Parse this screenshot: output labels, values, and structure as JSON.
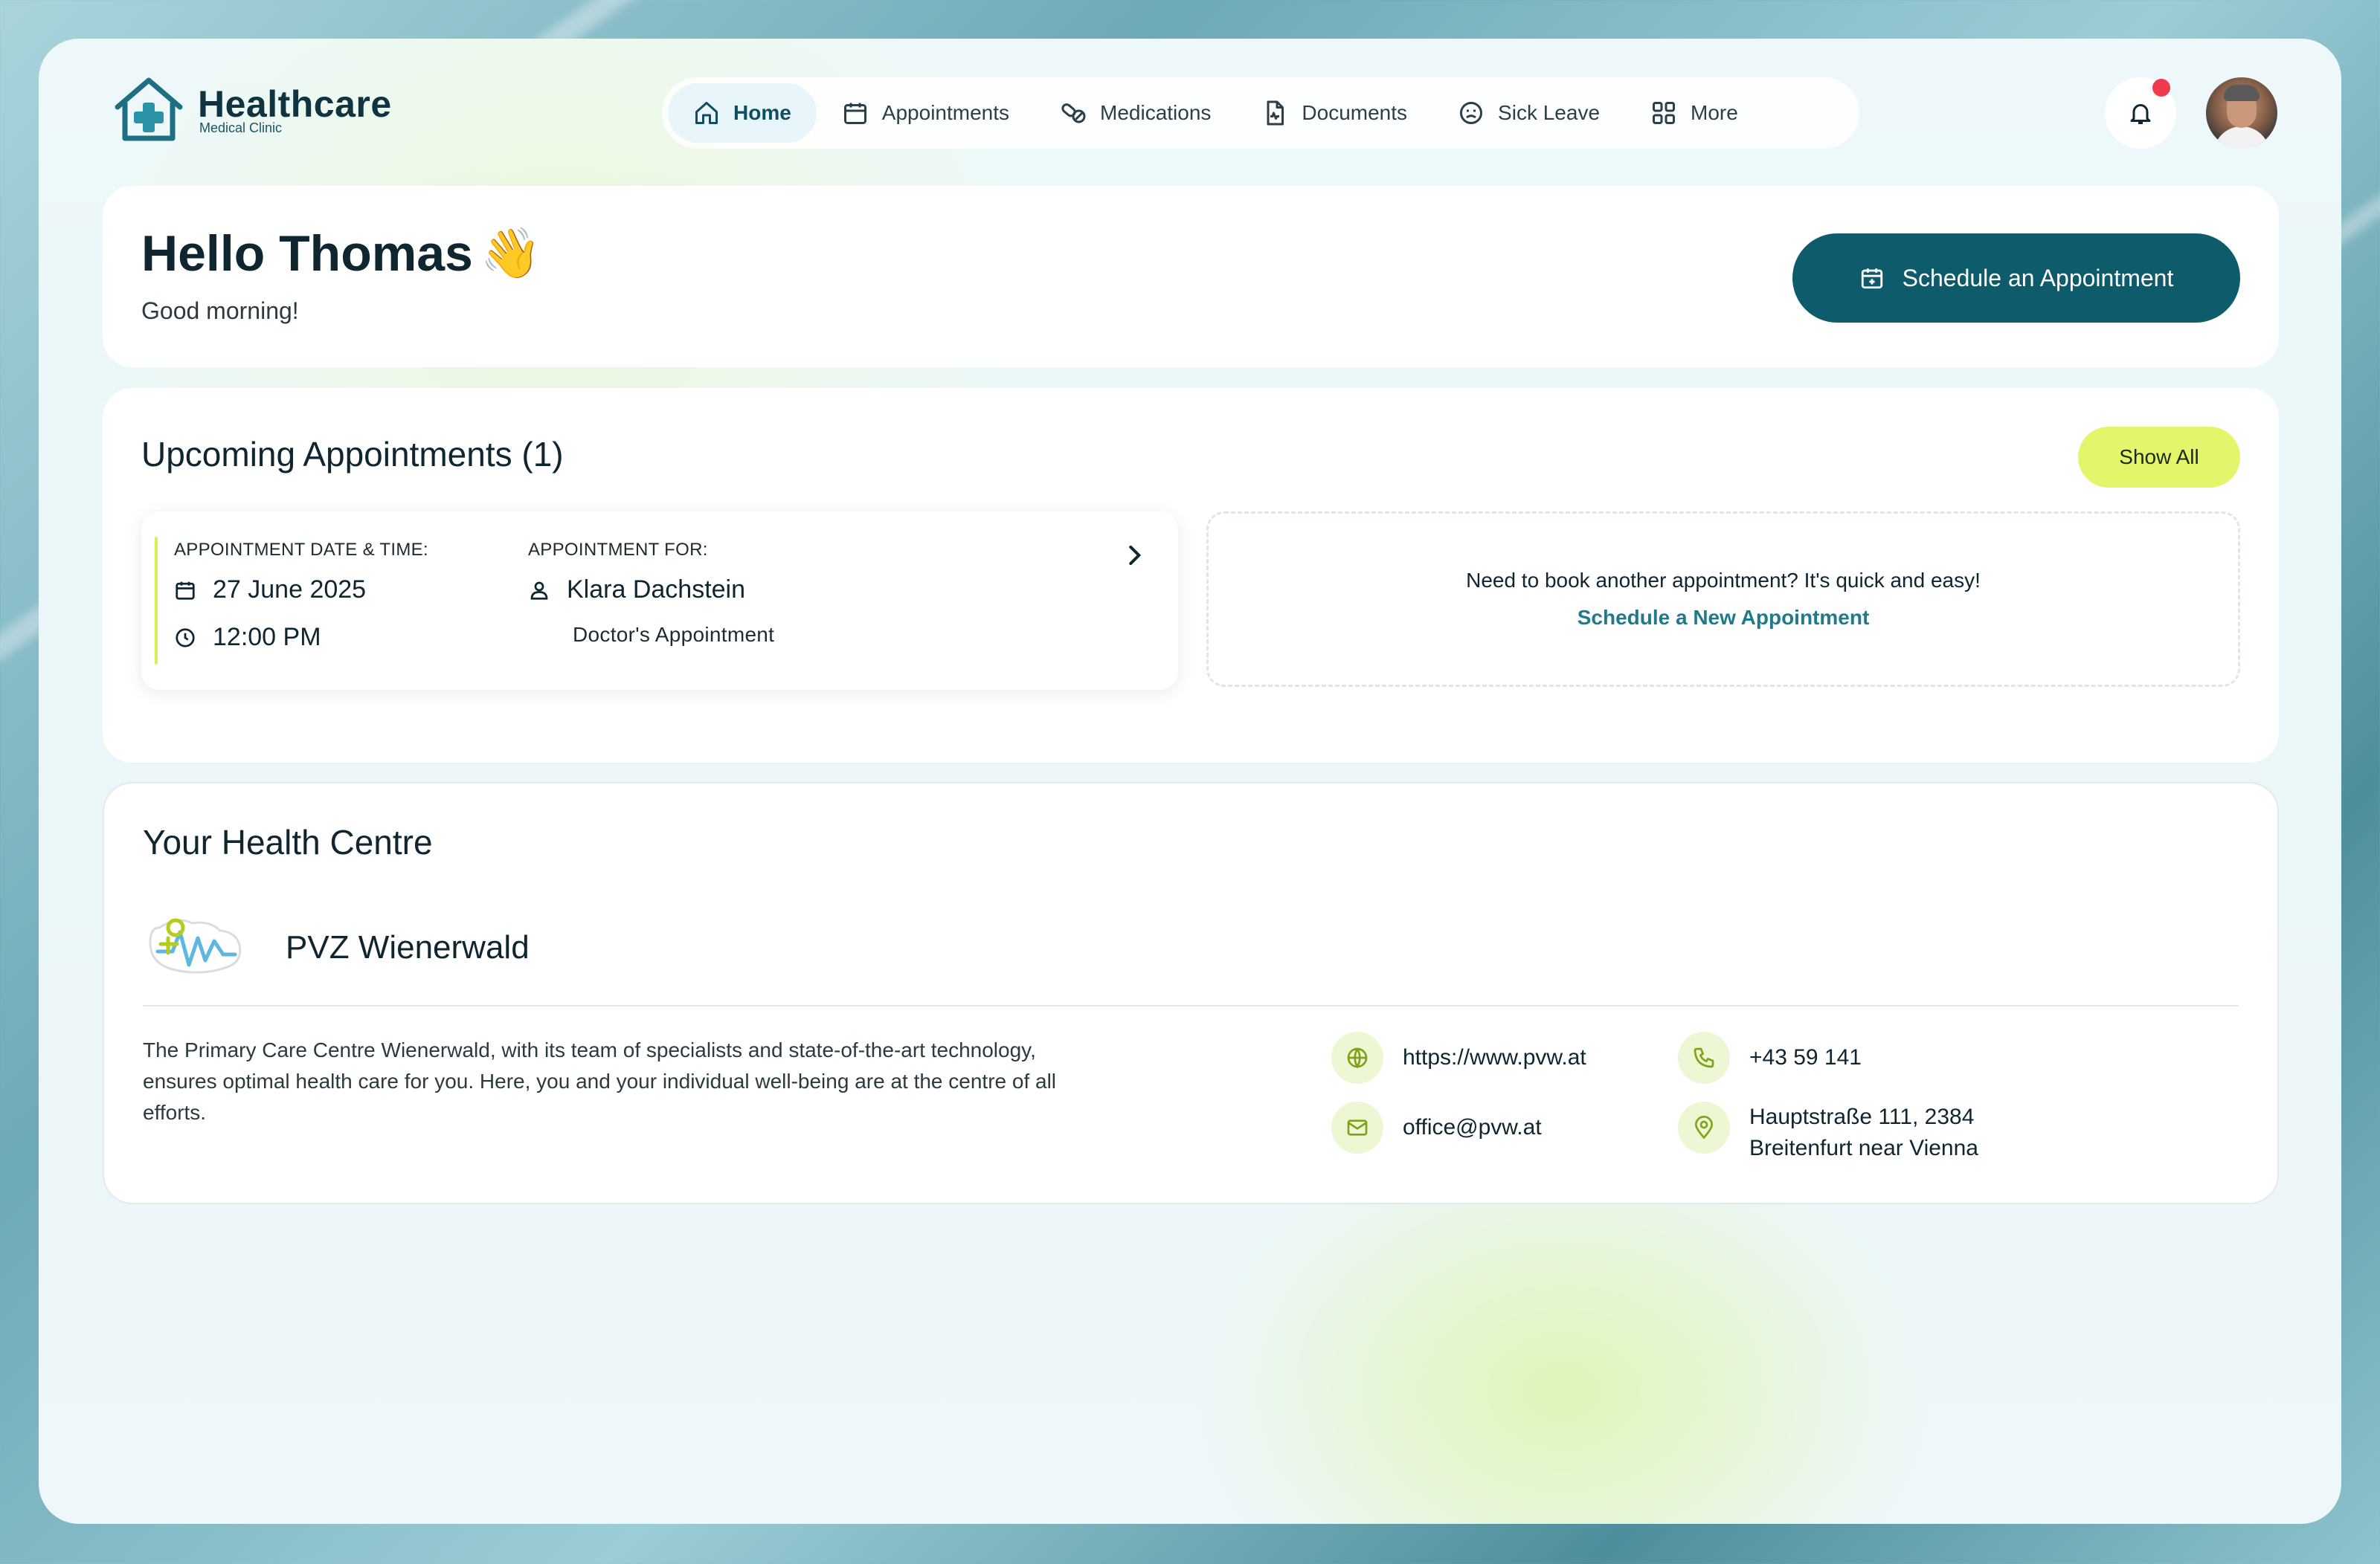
{
  "brand": {
    "title": "Healthcare",
    "subtitle": "Medical Clinic"
  },
  "nav": [
    {
      "label": "Home",
      "icon": "home-icon",
      "active": true
    },
    {
      "label": "Appointments",
      "icon": "calendar-icon"
    },
    {
      "label": "Medications",
      "icon": "pills-icon"
    },
    {
      "label": "Documents",
      "icon": "document-icon"
    },
    {
      "label": "Sick Leave",
      "icon": "sick-face-icon"
    },
    {
      "label": "More",
      "icon": "grid-icon"
    }
  ],
  "greeting": {
    "title": "Hello Thomas",
    "emoji": "👋",
    "subtitle": "Good morning!",
    "cta_label": "Schedule an Appointment"
  },
  "upcoming": {
    "title": "Upcoming Appointments (1)",
    "show_all_label": "Show All",
    "appointment": {
      "datetime_label": "APPOINTMENT DATE & TIME:",
      "date": "27 June 2025",
      "time": "12:00 PM",
      "for_label": "APPOINTMENT FOR:",
      "patient": "Klara Dachstein",
      "type": "Doctor's Appointment"
    },
    "book_prompt": "Need to book another appointment? It's quick and easy!",
    "book_link": "Schedule a New Appointment"
  },
  "health_centre": {
    "title": "Your Health Centre",
    "name": "PVZ Wienerwald",
    "description": "The Primary Care Centre Wienerwald, with its team of specialists and state-of-the-art technology, ensures optimal health care for you. Here, you and your individual well-being are at the centre of all efforts.",
    "website": "https://www.pvw.at",
    "phone": "+43 59 141",
    "email": "office@pvw.at",
    "address_line1": "Hauptstraße 111, 2384",
    "address_line2": "Breitenfurt near Vienna"
  },
  "colors": {
    "primary": "#0e5b6c",
    "accent": "#e4f56b",
    "link": "#1f7a8c",
    "notification": "#ef3b4d"
  }
}
